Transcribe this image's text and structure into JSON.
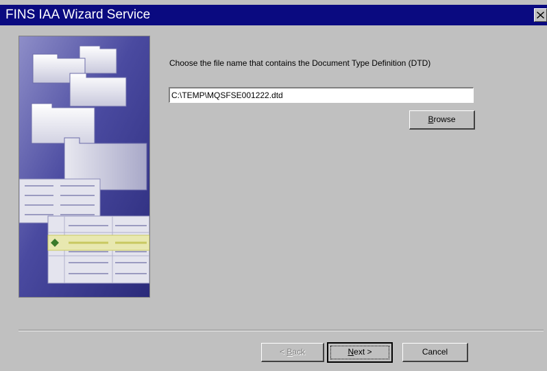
{
  "window": {
    "title": "FINS IAA Wizard Service",
    "close_glyph": "×"
  },
  "main": {
    "prompt": "Choose the file name that contains the Document Type Definition (DTD)",
    "file_path": "C:\\TEMP\\MQSFSE001222.dtd",
    "browse": {
      "mnemonic": "B",
      "rest": "rowse"
    }
  },
  "footer": {
    "back": {
      "prefix": "< ",
      "mnemonic": "B",
      "rest": "ack"
    },
    "next": {
      "mnemonic": "N",
      "rest": "ext >"
    },
    "cancel": "Cancel"
  },
  "art": {
    "icon": "folders-documents-illustration"
  },
  "colors": {
    "titlebar": "#0a0a80",
    "dialog": "#c0c0c0",
    "art_bg": "#3f3f94"
  }
}
